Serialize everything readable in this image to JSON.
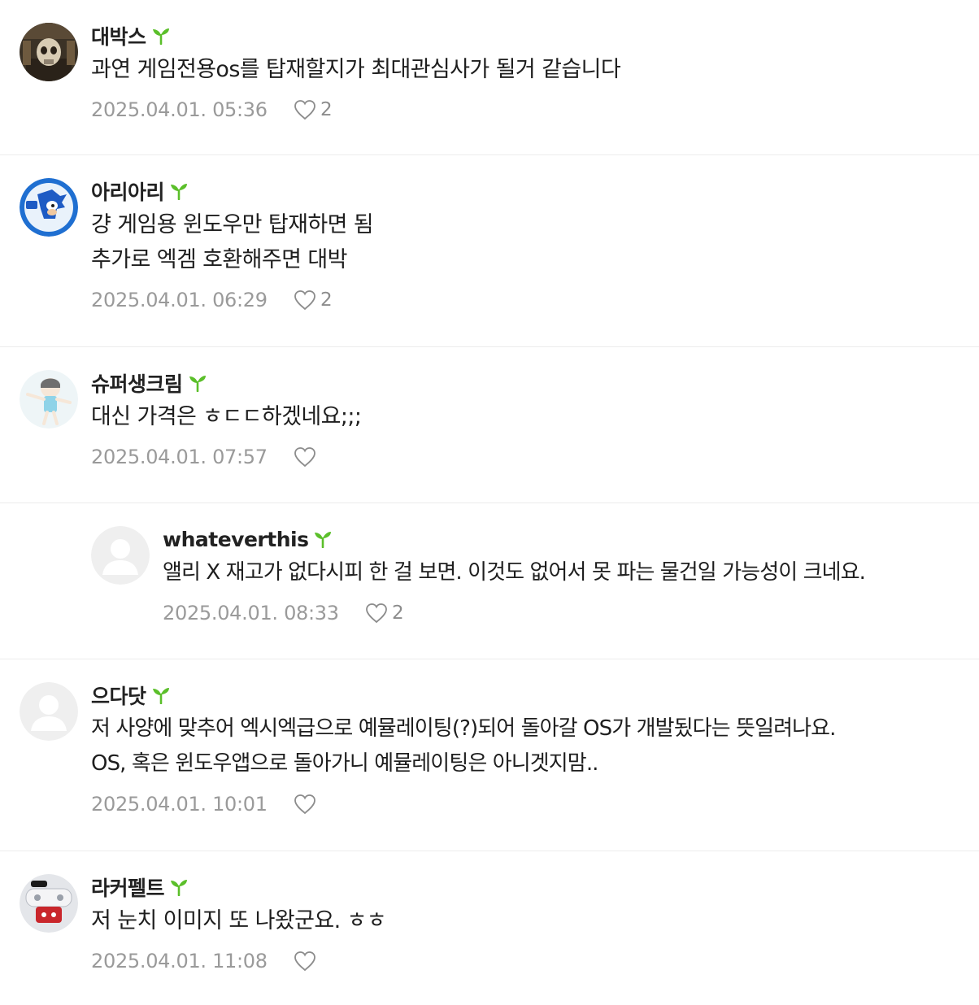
{
  "colors": {
    "sprout": "#5bbf2a",
    "divider": "#ececec",
    "meta_text": "#9a9a9a",
    "author_text": "#222222"
  },
  "comments": [
    {
      "author": "대박스",
      "avatar": "skull-avatar",
      "lines": [
        "과연 게임전용os를 탑재할지가 최대관심사가 될거 같습니다"
      ],
      "date": "2025.04.01. 05:36",
      "likes": "2"
    },
    {
      "author": "아리아리",
      "avatar": "sonic-avatar",
      "lines": [
        "걍 게임용 윈도우만 탑재하면 됨",
        "추가로 엑겜 호환해주면 대박"
      ],
      "date": "2025.04.01. 06:29",
      "likes": "2"
    },
    {
      "author": "슈퍼생크림",
      "avatar": "cartoon-girl-avatar",
      "lines": [
        "대신 가격은 ㅎㄷㄷ하겠네요;;;"
      ],
      "date": "2025.04.01. 07:57",
      "likes": ""
    },
    {
      "author": "whateverthis",
      "avatar": "default-avatar",
      "reply": true,
      "lines": [
        "앨리 X 재고가 없다시피 한 걸 보면. 이것도 없어서 못 파는 물건일 가능성이 크네요."
      ],
      "date": "2025.04.01. 08:33",
      "likes": "2"
    },
    {
      "author": "으다닷",
      "avatar": "default-avatar",
      "lines": [
        "저 사양에 맞추어 엑시엑급으로 예뮬레이팅(?)되어 돌아갈 OS가 개발됬다는 뜻일려나요.",
        "OS, 혹은 윈도우앱으로 돌아가니 예뮬레이팅은 아니겟지맘.."
      ],
      "date": "2025.04.01. 10:01",
      "likes": ""
    },
    {
      "author": "라커펠트",
      "avatar": "controller-avatar",
      "lines": [
        "저 눈치 이미지 또 나왔군요. ㅎㅎ"
      ],
      "date": "2025.04.01. 11:08",
      "likes": ""
    }
  ]
}
